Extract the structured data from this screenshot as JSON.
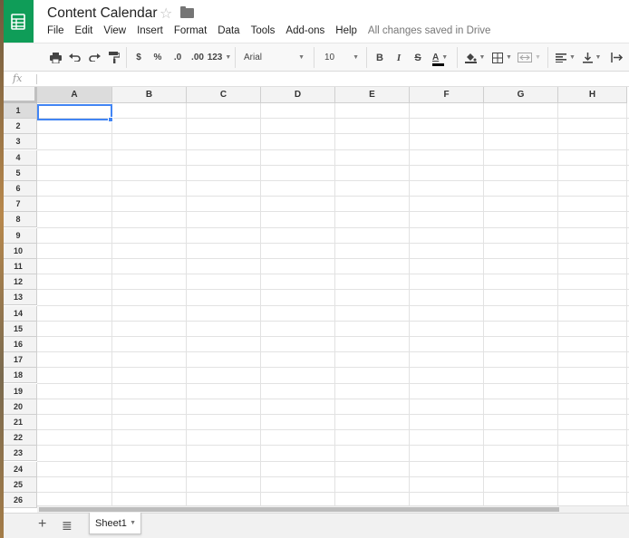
{
  "document": {
    "title": "Content Calendar",
    "save_status": "All changes saved in Drive"
  },
  "menu": {
    "items": [
      "File",
      "Edit",
      "View",
      "Insert",
      "Format",
      "Data",
      "Tools",
      "Add-ons",
      "Help"
    ]
  },
  "toolbar": {
    "currency_label": "$",
    "percent_label": "%",
    "decrease_decimals_label": ".0",
    "increase_decimals_label": ".00",
    "more_formats_label": "123",
    "font_family": "Arial",
    "font_size": "10",
    "bold_label": "B",
    "italic_label": "I",
    "strikethrough_label": "S",
    "text_color_label": "A",
    "icons": [
      "print-icon",
      "undo-icon",
      "redo-icon",
      "paint-format-icon",
      "fill-color-icon",
      "borders-icon",
      "merge-cells-icon",
      "align-left-icon",
      "vertical-align-icon",
      "text-wrap-icon"
    ]
  },
  "formula_bar": {
    "fx_label": "fx",
    "value": ""
  },
  "grid": {
    "columns": [
      "A",
      "B",
      "C",
      "D",
      "E",
      "F",
      "G",
      "H"
    ],
    "rows": [
      "1",
      "2",
      "3",
      "4",
      "5",
      "6",
      "7",
      "8",
      "9",
      "10",
      "11",
      "12",
      "13",
      "14",
      "15",
      "16",
      "17",
      "18",
      "19",
      "20",
      "21",
      "22",
      "23",
      "24",
      "25",
      "26"
    ],
    "active_cell": "A1"
  },
  "sheets": {
    "tabs": [
      "Sheet1"
    ],
    "active": "Sheet1"
  },
  "colors": {
    "brand": "#0f9d58",
    "selection": "#4285f4",
    "header_bg": "#f3f3f3"
  }
}
